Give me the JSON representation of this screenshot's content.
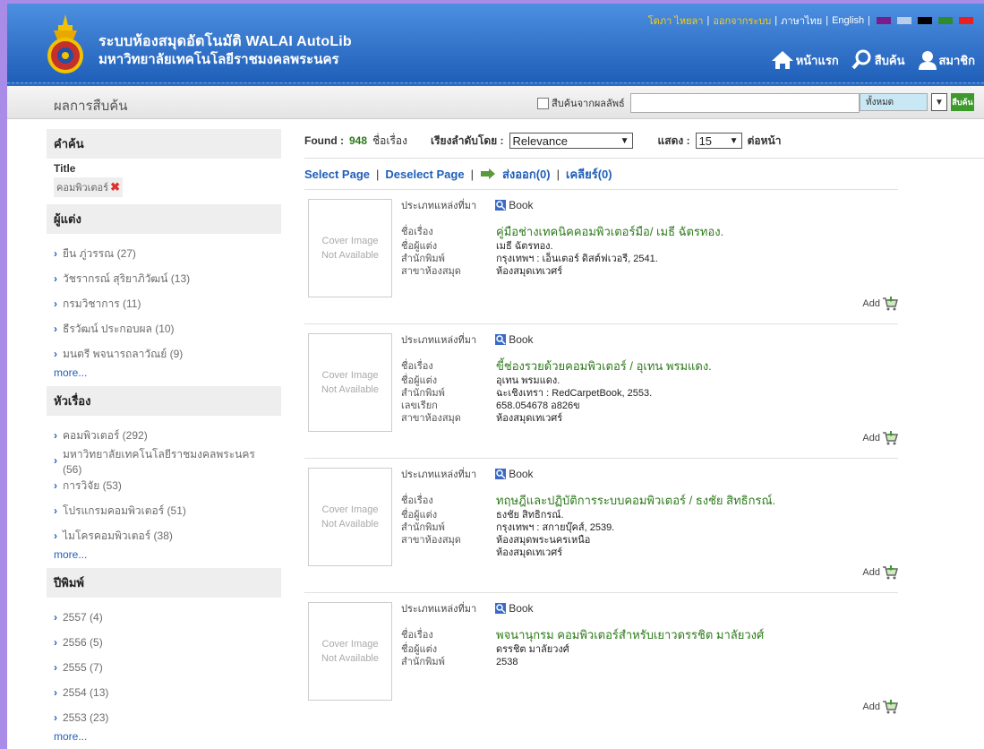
{
  "header": {
    "title_line1": "ระบบห้องสมุดอัตโนมัติ WALAI AutoLib",
    "title_line2": "มหาวิทยาลัยเทคโนโลยีราชมงคลพระนคร",
    "user_link": "โดภา ไหยลา",
    "logout_link": "ออกจากระบบ",
    "lang_thai": "ภาษาไทย",
    "lang_english": "English",
    "theme_colors": [
      "#7a1c8c",
      "#b9cde9",
      "#000000",
      "#2e8b2e",
      "#e82020"
    ],
    "nav": {
      "home": "หน้าแรก",
      "search": "สืบค้น",
      "member": "สมาชิก"
    }
  },
  "searchbar": {
    "page_title": "ผลการสืบค้น",
    "checkbox_label": "สืบค้นจากผลลัพธ์",
    "input_value": "",
    "scope_value": "ทั้งหมด",
    "button_label": "สืบค้น"
  },
  "sidebar": {
    "query_heading": "คำค้น",
    "query_field": "Title",
    "query_term": "คอมพิวเตอร์",
    "more_label": "more...",
    "facets": [
      {
        "heading": "ผู้แต่ง",
        "items": [
          "ยืน ภู่วรรณ (27)",
          "วัชรากรณ์ สุริยาภิวัฒน์ (13)",
          "กรมวิชาการ (11)",
          "ธีรวัฒน์ ประกอบผล (10)",
          "มนตรี พจนารถลาวัณย์ (9)"
        ]
      },
      {
        "heading": "หัวเรื่อง",
        "items": [
          "คอมพิวเตอร์ (292)",
          "มหาวิทยาลัยเทคโนโลยีราชมงคลพระนคร (56)",
          "การวิจัย (53)",
          "โปรแกรมคอมพิวเตอร์ (51)",
          "ไมโครคอมพิวเตอร์ (38)"
        ]
      },
      {
        "heading": "ปีพิมพ์",
        "items": [
          "2557 (4)",
          "2556 (5)",
          "2555 (7)",
          "2554 (13)",
          "2553 (23)"
        ]
      }
    ]
  },
  "results": {
    "found_label": "Found :",
    "found_count": "948",
    "found_unit": "ชื่อเรื่อง",
    "sort_label": "เรียงลำดับโดย :",
    "sort_value": "Relevance",
    "show_label": "แสดง :",
    "show_value": "15",
    "per_page_label": "ต่อหน้า",
    "select_page": "Select Page",
    "deselect_page": "Deselect Page",
    "export_label": "ส่งออก(0)",
    "clear_label": "เคลียร์(0)",
    "cover_line1": "Cover Image",
    "cover_line2": "Not Available",
    "type_label": "ประเภทแหล่งที่มา",
    "type_value": "Book",
    "add_label": "Add",
    "records": [
      {
        "fields": [
          {
            "label": "ชื่อเรื่อง",
            "value": "คู่มือช่างเทคนิคคอมพิวเตอร์มือ/ เมธี ฉัตรทอง.",
            "title": true
          },
          {
            "label": "ชื่อผู้แต่ง",
            "value": "เมธี ฉัตรทอง."
          },
          {
            "label": "สำนักพิมพ์",
            "value": "กรุงเทพฯ : เอ็นเตอร์ ดิสต์ฟเวอรี, 2541."
          },
          {
            "label": "สาขาห้องสมุด",
            "value": "ห้องสมุดเทเวศร์"
          }
        ]
      },
      {
        "fields": [
          {
            "label": "ชื่อเรื่อง",
            "value": "ขี้ช่องรวยด้วยคอมพิวเตอร์ / อุเทน พรมแดง.",
            "title": true
          },
          {
            "label": "ชื่อผู้แต่ง",
            "value": "อุเทน พรมแดง."
          },
          {
            "label": "สำนักพิมพ์",
            "value": "ฉะเชิงเทรา : RedCarpetBook, 2553."
          },
          {
            "label": "เลขเรียก",
            "value": "658.054678 อ826ข"
          },
          {
            "label": "สาขาห้องสมุด",
            "value": "ห้องสมุดเทเวศร์"
          }
        ]
      },
      {
        "fields": [
          {
            "label": "ชื่อเรื่อง",
            "value": "ทฤษฎีและปฏิบัติการระบบคอมพิวเตอร์ / ธงชัย สิทธิกรณ์.",
            "title": true
          },
          {
            "label": "ชื่อผู้แต่ง",
            "value": "ธงชัย สิทธิกรณ์."
          },
          {
            "label": "สำนักพิมพ์",
            "value": "กรุงเทพฯ : สกายบุ๊คส์, 2539."
          },
          {
            "label": "สาขาห้องสมุด",
            "value": "ห้องสมุดพระนครเหนือ"
          },
          {
            "label": "",
            "value": "ห้องสมุดเทเวศร์"
          }
        ]
      },
      {
        "fields": [
          {
            "label": "ชื่อเรื่อง",
            "value": "พจนานุกรม คอมพิวเตอร์สำหรับเยาวดรรชิต มาลัยวงศ์",
            "title": true
          },
          {
            "label": "ชื่อผู้แต่ง",
            "value": "ดรรชิต มาลัยวงศ์"
          },
          {
            "label": "สำนักพิมพ์",
            "value": "2538"
          }
        ]
      }
    ]
  }
}
